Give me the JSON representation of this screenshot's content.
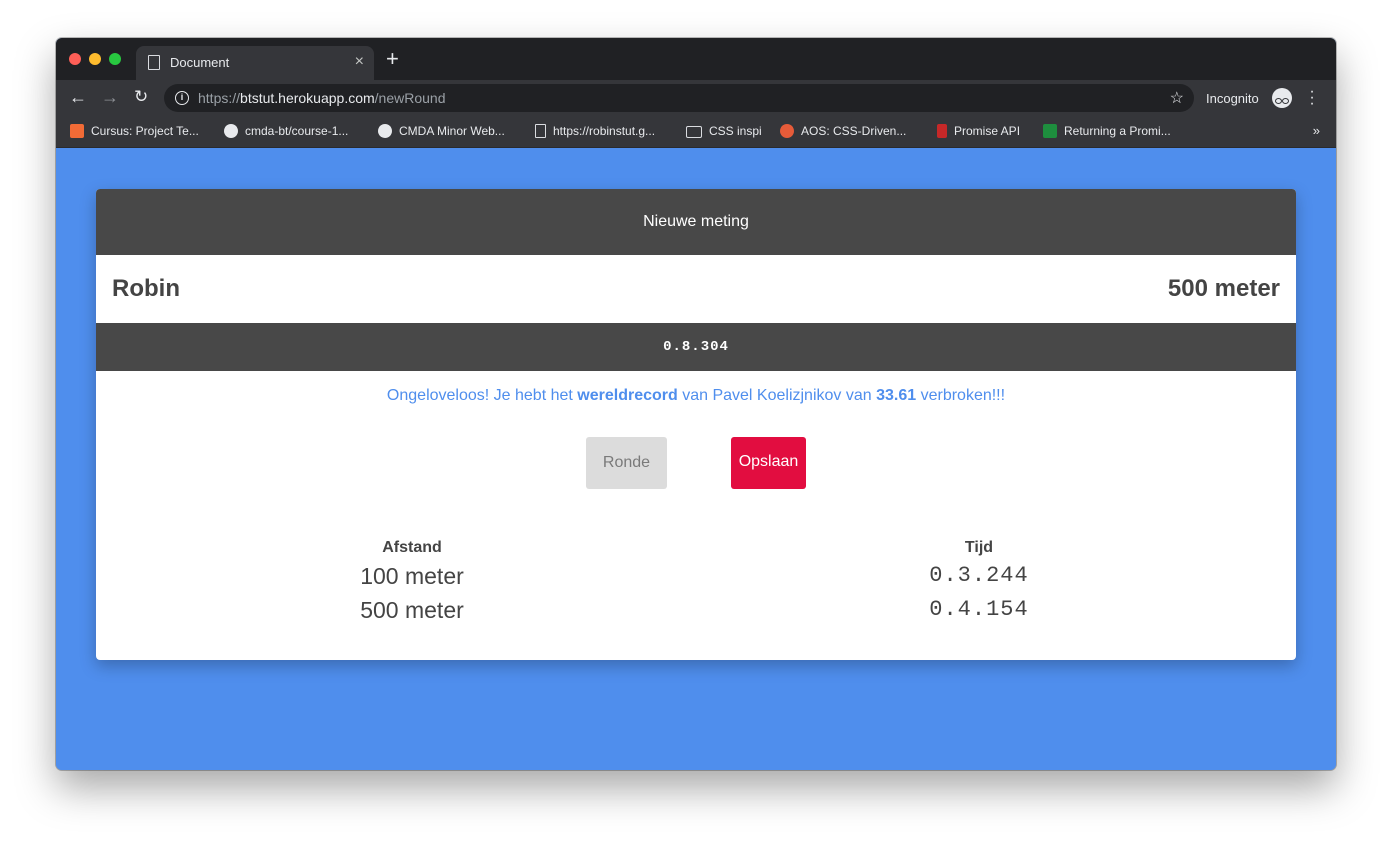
{
  "browser": {
    "tab_title": "Document",
    "tab_close": "×",
    "new_tab": "+",
    "url_scheme": "https://",
    "url_host": "btstut.herokuapp.com",
    "url_path": "/newRound",
    "incognito_label": "Incognito",
    "bookmarks": [
      {
        "label": "Cursus: Project Te...",
        "icon": "invision-icon"
      },
      {
        "label": "cmda-bt/course-1...",
        "icon": "github-icon"
      },
      {
        "label": "CMDA Minor Web...",
        "icon": "github-icon"
      },
      {
        "label": "https://robinstut.g...",
        "icon": "page-icon"
      },
      {
        "label": "CSS inspi",
        "icon": "folder-icon"
      },
      {
        "label": "AOS: CSS-Driven...",
        "icon": "aos-icon"
      },
      {
        "label": "Promise API",
        "icon": "promise-icon"
      },
      {
        "label": "Returning a Promi...",
        "icon": "returning-icon"
      }
    ],
    "bookmarks_more": "»"
  },
  "card": {
    "header": "Nieuwe meting",
    "athlete_name": "Robin",
    "distance": "500 meter",
    "timer": "0.8.304",
    "message": {
      "part1": "Ongeloveloos! Je hebt het ",
      "bold1": "wereldrecord",
      "part2": " van Pavel Koelizjnikov van ",
      "bold2": "33.61",
      "part3": " verbroken!!!"
    },
    "buttons": {
      "ronde": "Ronde",
      "opslaan": "Opslaan"
    },
    "table": {
      "headers": [
        "Afstand",
        "Tijd"
      ],
      "rows": [
        [
          "100 meter",
          "0.3.244"
        ],
        [
          "500 meter",
          "0.4.154"
        ]
      ]
    }
  },
  "colors": {
    "page_background": "#4f8eed",
    "header_dark": "#484848",
    "save_button": "#e20d40",
    "message_text": "#4f8eed"
  }
}
